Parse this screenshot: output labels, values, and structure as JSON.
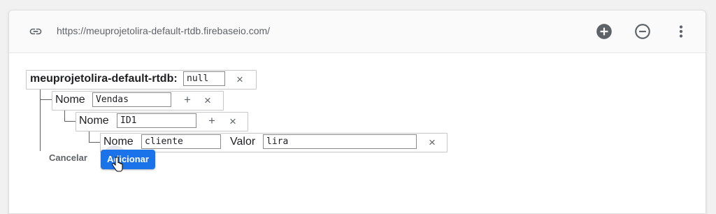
{
  "header": {
    "url": "https://meuprojetolira-default-rtdb.firebaseio.com/",
    "link_icon": "link-icon",
    "add_icon": "add-circle-icon",
    "remove_icon": "remove-circle-icon",
    "more_icon": "more-vert-icon"
  },
  "root": {
    "key": "meuprojetolira-default-rtdb:",
    "value": "null",
    "remove": "×"
  },
  "child1": {
    "name_label": "Nome",
    "name_value": "Vendas",
    "add": "+",
    "remove": "×"
  },
  "child2": {
    "name_label": "Nome",
    "name_value": "ID1",
    "add": "+",
    "remove": "×"
  },
  "child3": {
    "name_label": "Nome",
    "name_value": "cliente",
    "value_label": "Valor",
    "value_value": "lira",
    "remove": "×"
  },
  "actions": {
    "cancel": "Cancelar",
    "add": "Adicionar"
  },
  "colors": {
    "primary": "#1a73e8",
    "panel": "#ffffff",
    "background": "#f1f1f1"
  }
}
